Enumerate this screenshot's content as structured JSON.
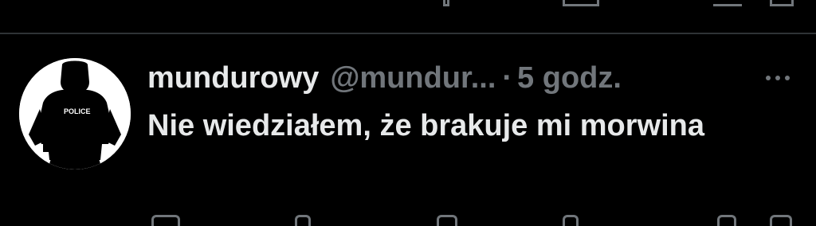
{
  "colors": {
    "background": "#000000",
    "primary_text": "#e7e9ea",
    "secondary_text": "#71767b",
    "divider": "#2f3336"
  },
  "tweet": {
    "display_name": "mundurowy",
    "handle": "@mundur...",
    "separator": "·",
    "time": "5 godz.",
    "text": "Nie wiedziałem, że brakuje mi morwina",
    "avatar": {
      "icon": "police-officer-silhouette-icon",
      "badge_text": "POLICE"
    },
    "more_icon": "ellipsis-icon"
  }
}
